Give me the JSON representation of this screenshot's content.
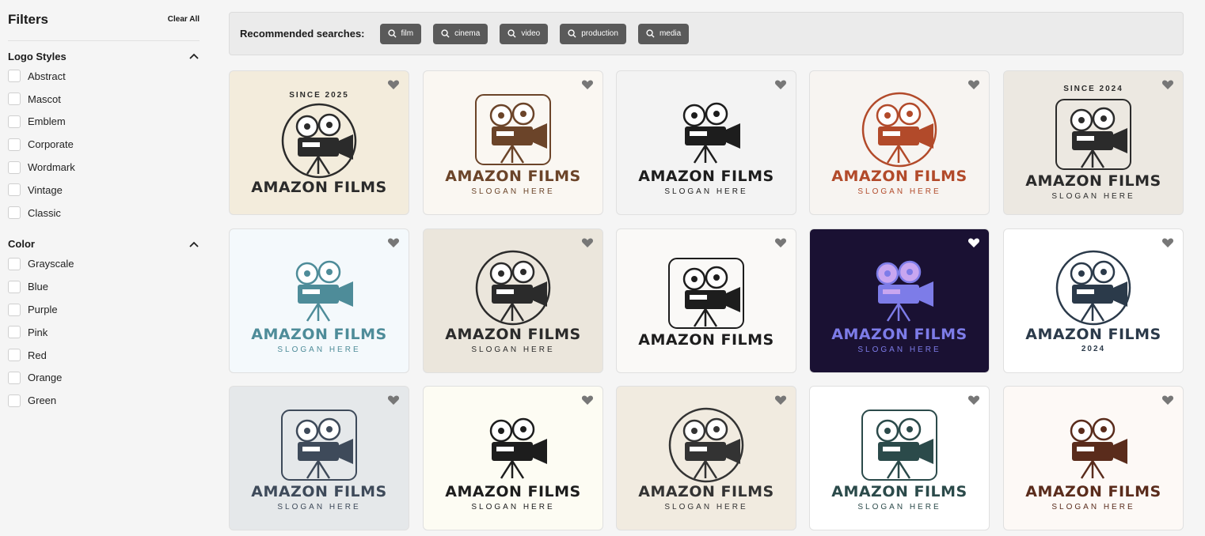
{
  "sidebar": {
    "title": "Filters",
    "clear_all": "Clear All",
    "logo_styles": {
      "title": "Logo Styles",
      "options": [
        "Abstract",
        "Mascot",
        "Emblem",
        "Corporate",
        "Wordmark",
        "Vintage",
        "Classic"
      ]
    },
    "color": {
      "title": "Color",
      "options": [
        "Grayscale",
        "Blue",
        "Purple",
        "Pink",
        "Red",
        "Orange",
        "Green"
      ]
    }
  },
  "recommended": {
    "label": "Recommended searches:",
    "chips": [
      "film",
      "cinema",
      "video",
      "production",
      "media"
    ]
  },
  "cards": [
    {
      "brand": "AMAZON FILMS",
      "badge_top": "SINCE 2025",
      "slogan": "",
      "bg": "#f3ecdc",
      "fg": "#2b2b2b",
      "fav_color": "#777777"
    },
    {
      "brand": "AMAZON FILMS",
      "slogan": "SLOGAN HERE",
      "bg": "#faf7f2",
      "fg": "#6b4429",
      "fav_color": "#777777"
    },
    {
      "brand": "AMAZON FILMS",
      "slogan": "SLOGAN HERE",
      "bg": "#f3f3f3",
      "fg": "#1d1d1d",
      "fav_color": "#777777"
    },
    {
      "brand": "AMAZON FILMS",
      "slogan": "SLOGAN HERE",
      "bg": "#f7f4f1",
      "fg": "#b24a2a",
      "fav_color": "#777777"
    },
    {
      "brand": "AMAZON FILMS",
      "badge_top": "SINCE 2024",
      "slogan": "SLOGAN HERE",
      "bg": "#ece8e1",
      "fg": "#2b2b2b",
      "fav_color": "#777777"
    },
    {
      "brand": "AMAZON FILMS",
      "slogan": "SLOGAN HERE",
      "bg": "#f4f9fc",
      "fg": "#4e8c99",
      "fav_color": "#777777"
    },
    {
      "brand": "AMAZON FILMS",
      "slogan": "SLOGAN HERE",
      "bg": "#ebe6dc",
      "fg": "#2b2b2b",
      "fav_color": "#777777"
    },
    {
      "brand": "AMAZON FILMS",
      "slogan": "",
      "bg": "#faf9f7",
      "fg": "#1d1d1d",
      "fav_color": "#777777"
    },
    {
      "brand": "AMAZON FILMS",
      "slogan": "SLOGAN HERE",
      "bg": "#1a1133",
      "fg": "#7d7ce8",
      "fav_color": "#ffffff"
    },
    {
      "brand": "AMAZON FILMS",
      "badge_bottom": "2024",
      "slogan": "",
      "bg": "#ffffff",
      "fg": "#2b3a4a",
      "fav_color": "#777777"
    },
    {
      "brand": "AMAZON FILMS",
      "slogan": "SLOGAN HERE",
      "bg": "#e5e8ea",
      "fg": "#3e4a5a",
      "fav_color": "#777777"
    },
    {
      "brand": "AMAZON FILMS",
      "slogan": "SLOGAN HERE",
      "bg": "#fdfcf3",
      "fg": "#1d1d1d",
      "fav_color": "#777777"
    },
    {
      "brand": "AMAZON FILMS",
      "slogan": "SLOGAN HERE",
      "bg": "#f1ebe0",
      "fg": "#333333",
      "fav_color": "#777777"
    },
    {
      "brand": "AMAZON FILMS",
      "slogan": "SLOGAN HERE",
      "bg": "#ffffff",
      "fg": "#2b4a4a",
      "fav_color": "#777777"
    },
    {
      "brand": "AMAZON FILMS",
      "slogan": "SLOGAN HERE",
      "bg": "#fdf9f6",
      "fg": "#5a2c1c",
      "fav_color": "#777777"
    }
  ]
}
